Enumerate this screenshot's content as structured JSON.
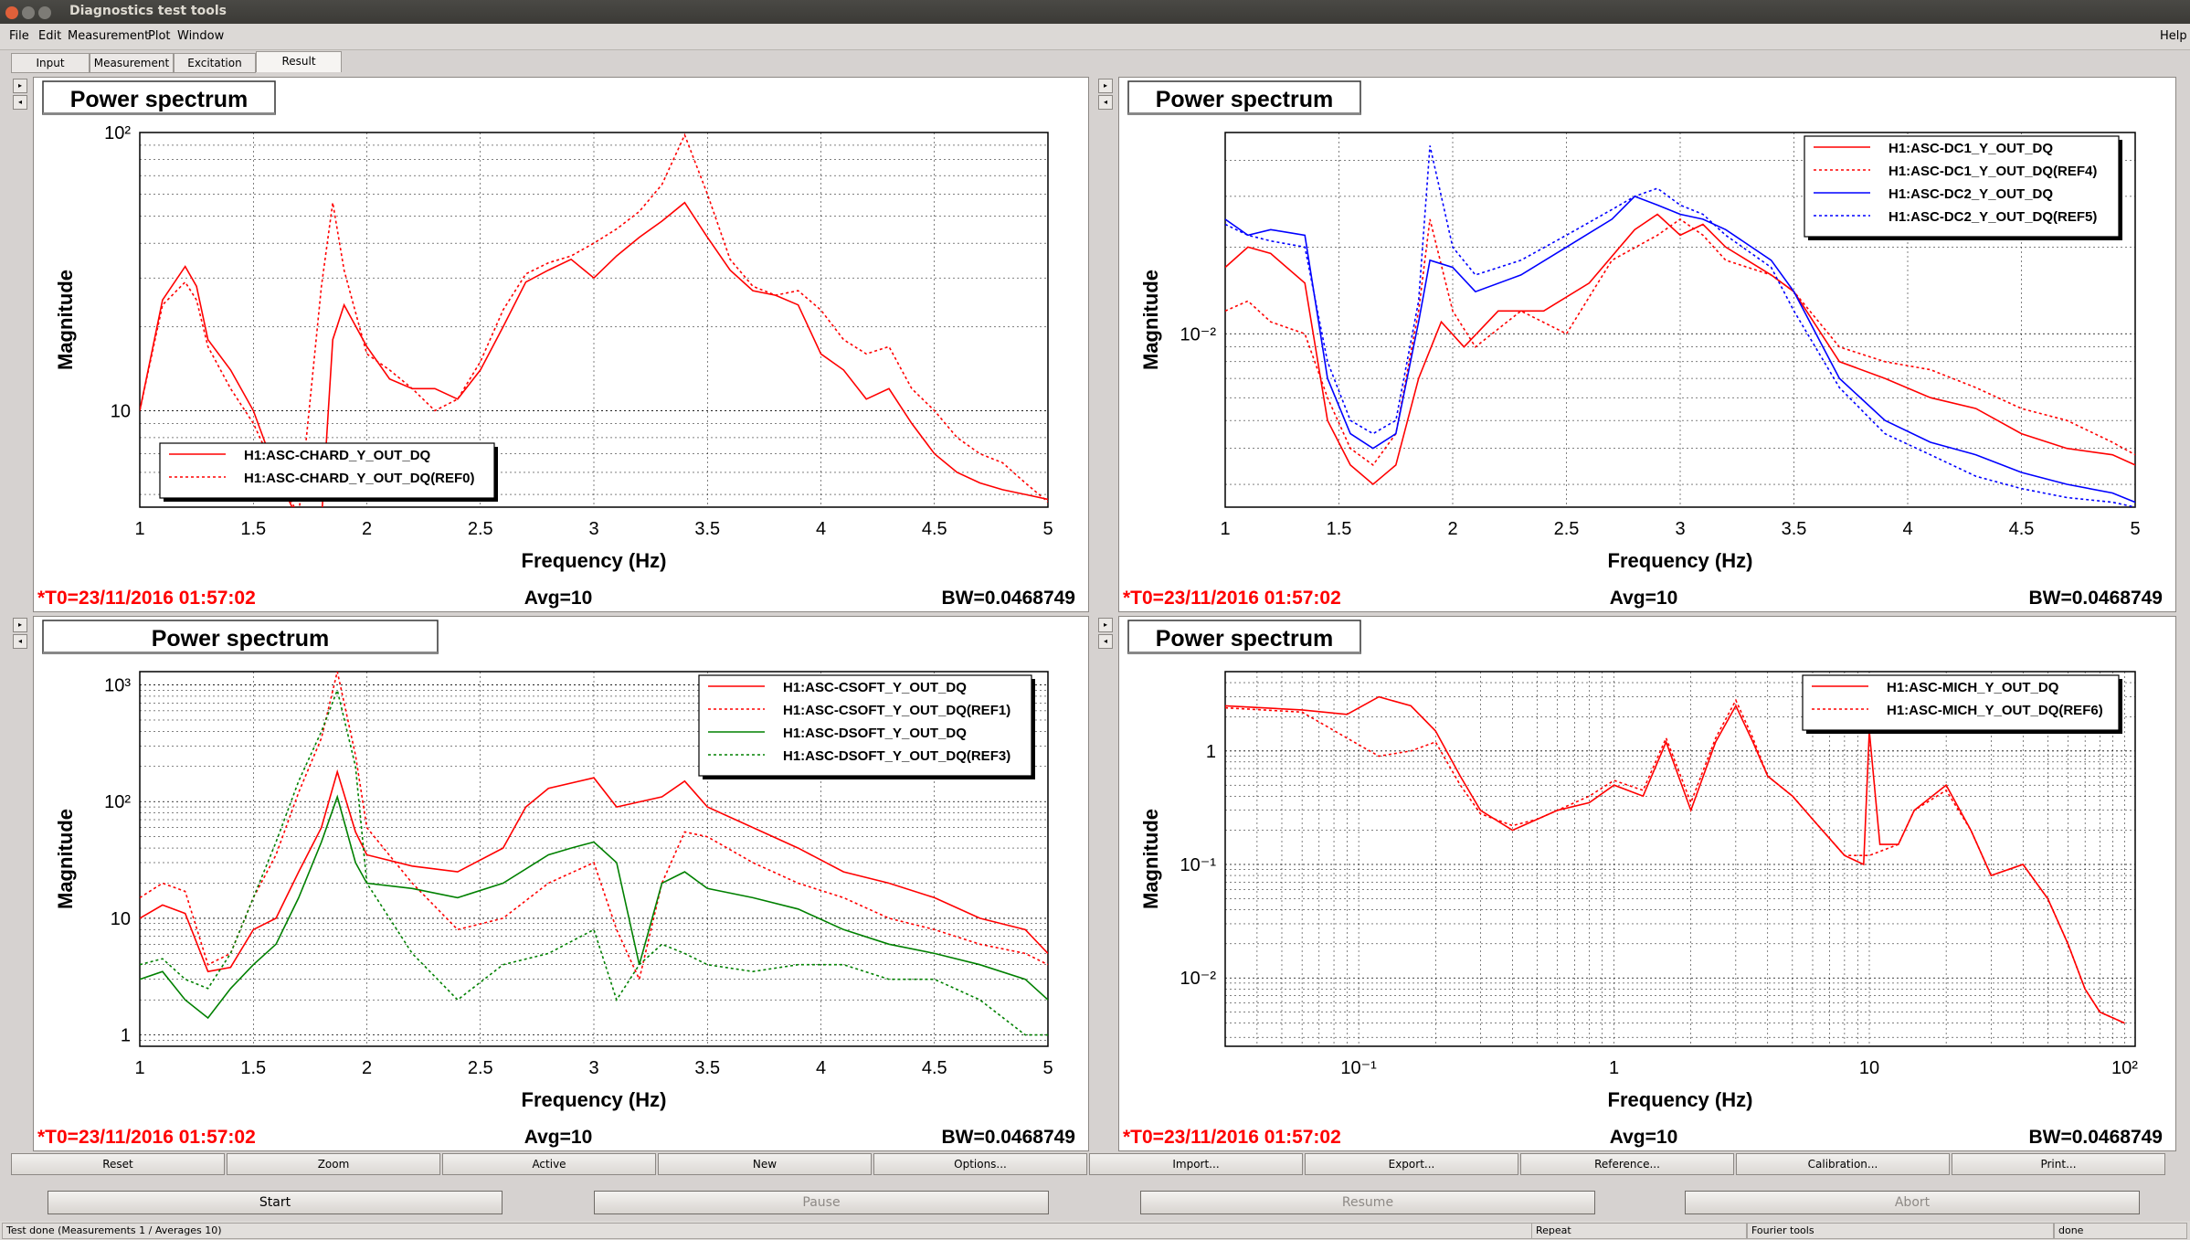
{
  "window": {
    "title": "Diagnostics test tools"
  },
  "menu": {
    "file": "File",
    "edit": "Edit",
    "measurement": "Measurement",
    "plot": "Plot",
    "window": "Window",
    "help": "Help"
  },
  "tabs": [
    "Input",
    "Measurement",
    "Excitation",
    "Result"
  ],
  "active_tab": "Result",
  "plots": [
    {
      "title": "Power spectrum",
      "t0": "*T0=23/11/2016 01:57:02",
      "avg": "Avg=10",
      "bw": "BW=0.0468749",
      "xlabel": "Frequency (Hz)",
      "ylabel": "Magnitude",
      "legend": [
        "H1:ASC-CHARD_Y_OUT_DQ",
        "H1:ASC-CHARD_Y_OUT_DQ(REF0)"
      ]
    },
    {
      "title": "Power spectrum",
      "t0": "*T0=23/11/2016 01:57:02",
      "avg": "Avg=10",
      "bw": "BW=0.0468749",
      "xlabel": "Frequency (Hz)",
      "ylabel": "Magnitude",
      "legend": [
        "H1:ASC-DC1_Y_OUT_DQ",
        "H1:ASC-DC1_Y_OUT_DQ(REF4)",
        "H1:ASC-DC2_Y_OUT_DQ",
        "H1:ASC-DC2_Y_OUT_DQ(REF5)"
      ]
    },
    {
      "title": "Power spectrum",
      "t0": "*T0=23/11/2016 01:57:02",
      "avg": "Avg=10",
      "bw": "BW=0.0468749",
      "xlabel": "Frequency (Hz)",
      "ylabel": "Magnitude",
      "legend": [
        "H1:ASC-CSOFT_Y_OUT_DQ",
        "H1:ASC-CSOFT_Y_OUT_DQ(REF1)",
        "H1:ASC-DSOFT_Y_OUT_DQ",
        "H1:ASC-DSOFT_Y_OUT_DQ(REF3)"
      ]
    },
    {
      "title": "Power spectrum",
      "t0": "*T0=23/11/2016 01:57:02",
      "avg": "Avg=10",
      "bw": "BW=0.0468749",
      "xlabel": "Frequency (Hz)",
      "ylabel": "Magnitude",
      "legend": [
        "H1:ASC-MICH_Y_OUT_DQ",
        "H1:ASC-MICH_Y_OUT_DQ(REF6)"
      ]
    }
  ],
  "chart_data": [
    {
      "type": "line",
      "x_axis": {
        "min": 1,
        "max": 5,
        "ticks": [
          "1",
          "1.5",
          "2",
          "2.5",
          "3",
          "3.5",
          "4",
          "4.5",
          "5"
        ]
      },
      "y_axis": {
        "scale": "log",
        "min": 4.5,
        "max": 100,
        "ticks": [
          "10",
          "10²"
        ]
      },
      "series": [
        {
          "name": "H1:ASC-CHARD_Y_OUT_DQ",
          "color": "#ff0000",
          "dash": "solid",
          "x": [
            1.0,
            1.1,
            1.2,
            1.25,
            1.3,
            1.4,
            1.5,
            1.6,
            1.7,
            1.8,
            1.85,
            1.9,
            2.0,
            2.1,
            2.2,
            2.3,
            2.4,
            2.5,
            2.6,
            2.7,
            2.8,
            2.9,
            3.0,
            3.1,
            3.2,
            3.3,
            3.4,
            3.5,
            3.6,
            3.7,
            3.8,
            3.9,
            4.0,
            4.1,
            4.2,
            4.3,
            4.4,
            4.5,
            4.6,
            4.7,
            4.8,
            4.9,
            5.0
          ],
          "y": [
            10,
            25,
            33,
            28,
            18,
            14,
            10,
            6,
            4,
            4,
            18,
            24,
            17,
            13,
            12,
            12,
            11,
            14,
            20,
            29,
            32,
            35,
            30,
            36,
            42,
            48,
            56,
            42,
            32,
            27,
            26,
            24,
            16,
            14,
            11,
            12,
            9,
            7,
            6,
            5.5,
            5.2,
            5,
            4.8
          ]
        },
        {
          "name": "H1:ASC-CHARD_Y_OUT_DQ(REF0)",
          "color": "#ff0000",
          "dash": "dotted",
          "x": [
            1.0,
            1.1,
            1.2,
            1.25,
            1.3,
            1.4,
            1.5,
            1.6,
            1.7,
            1.8,
            1.85,
            1.9,
            2.0,
            2.1,
            2.2,
            2.3,
            2.4,
            2.5,
            2.6,
            2.7,
            2.8,
            2.9,
            3.0,
            3.1,
            3.2,
            3.3,
            3.4,
            3.5,
            3.6,
            3.7,
            3.8,
            3.9,
            4.0,
            4.1,
            4.2,
            4.3,
            4.4,
            4.5,
            4.6,
            4.7,
            4.8,
            4.9,
            5.0
          ],
          "y": [
            10,
            24,
            29,
            25,
            17,
            12,
            9,
            6,
            4.2,
            28,
            56,
            32,
            16,
            14,
            12,
            10,
            11,
            15,
            23,
            31,
            34,
            36,
            40,
            45,
            52,
            65,
            98,
            60,
            35,
            28,
            26,
            27,
            23,
            18,
            16,
            17,
            12,
            10,
            8,
            7,
            6.5,
            5.5,
            4.7
          ]
        }
      ]
    },
    {
      "type": "line",
      "x_axis": {
        "min": 1,
        "max": 5,
        "ticks": [
          "1",
          "1.5",
          "2",
          "2.5",
          "3",
          "3.5",
          "4",
          "4.5",
          "5"
        ]
      },
      "y_axis": {
        "scale": "log",
        "min": 0.0025,
        "max": 0.05,
        "ticks": [
          "10⁻²"
        ]
      },
      "series": [
        {
          "name": "H1:ASC-DC1_Y_OUT_DQ",
          "color": "#ff0000",
          "dash": "solid",
          "x": [
            1.0,
            1.1,
            1.2,
            1.35,
            1.45,
            1.55,
            1.65,
            1.75,
            1.85,
            1.95,
            2.05,
            2.2,
            2.4,
            2.6,
            2.8,
            2.9,
            3.0,
            3.1,
            3.2,
            3.4,
            3.5,
            3.7,
            3.9,
            4.1,
            4.3,
            4.5,
            4.7,
            4.9,
            5.0
          ],
          "y": [
            0.017,
            0.02,
            0.019,
            0.015,
            0.005,
            0.0035,
            0.003,
            0.0035,
            0.007,
            0.011,
            0.009,
            0.012,
            0.012,
            0.015,
            0.023,
            0.026,
            0.022,
            0.024,
            0.02,
            0.016,
            0.014,
            0.008,
            0.007,
            0.006,
            0.0055,
            0.0045,
            0.004,
            0.0038,
            0.0035
          ]
        },
        {
          "name": "H1:ASC-DC1_Y_OUT_DQ(REF4)",
          "color": "#ff0000",
          "dash": "dotted",
          "x": [
            1.0,
            1.1,
            1.2,
            1.35,
            1.45,
            1.55,
            1.65,
            1.75,
            1.85,
            1.9,
            2.0,
            2.1,
            2.3,
            2.5,
            2.7,
            2.9,
            3.0,
            3.1,
            3.2,
            3.4,
            3.5,
            3.7,
            3.9,
            4.1,
            4.3,
            4.5,
            4.7,
            4.9,
            5.0
          ],
          "y": [
            0.012,
            0.013,
            0.011,
            0.01,
            0.006,
            0.004,
            0.0035,
            0.0045,
            0.012,
            0.025,
            0.012,
            0.009,
            0.012,
            0.01,
            0.018,
            0.022,
            0.025,
            0.022,
            0.018,
            0.016,
            0.014,
            0.009,
            0.008,
            0.0075,
            0.0065,
            0.0055,
            0.005,
            0.0042,
            0.0038
          ]
        },
        {
          "name": "H1:ASC-DC2_Y_OUT_DQ",
          "color": "#0000ff",
          "dash": "solid",
          "x": [
            1.0,
            1.1,
            1.2,
            1.35,
            1.45,
            1.55,
            1.65,
            1.75,
            1.85,
            1.9,
            2.0,
            2.1,
            2.3,
            2.5,
            2.7,
            2.8,
            2.9,
            3.0,
            3.1,
            3.2,
            3.4,
            3.5,
            3.7,
            3.9,
            4.1,
            4.3,
            4.5,
            4.7,
            4.9,
            5.0
          ],
          "y": [
            0.025,
            0.022,
            0.023,
            0.022,
            0.007,
            0.0045,
            0.004,
            0.0045,
            0.011,
            0.018,
            0.017,
            0.014,
            0.016,
            0.02,
            0.025,
            0.03,
            0.028,
            0.026,
            0.025,
            0.023,
            0.018,
            0.014,
            0.007,
            0.005,
            0.0042,
            0.0038,
            0.0033,
            0.003,
            0.0028,
            0.0026
          ]
        },
        {
          "name": "H1:ASC-DC2_Y_OUT_DQ(REF5)",
          "color": "#0000ff",
          "dash": "dotted",
          "x": [
            1.0,
            1.1,
            1.2,
            1.35,
            1.45,
            1.55,
            1.65,
            1.75,
            1.85,
            1.9,
            2.0,
            2.1,
            2.3,
            2.5,
            2.7,
            2.8,
            2.9,
            3.0,
            3.1,
            3.2,
            3.4,
            3.5,
            3.7,
            3.9,
            4.1,
            4.3,
            4.5,
            4.7,
            4.9,
            5.0
          ],
          "y": [
            0.024,
            0.022,
            0.021,
            0.02,
            0.008,
            0.005,
            0.0045,
            0.005,
            0.013,
            0.045,
            0.02,
            0.016,
            0.018,
            0.022,
            0.027,
            0.03,
            0.032,
            0.028,
            0.026,
            0.022,
            0.017,
            0.012,
            0.0065,
            0.0045,
            0.0038,
            0.0032,
            0.0029,
            0.0027,
            0.0026,
            0.0025
          ]
        }
      ]
    },
    {
      "type": "line",
      "x_axis": {
        "min": 1,
        "max": 5,
        "ticks": [
          "1",
          "1.5",
          "2",
          "2.5",
          "3",
          "3.5",
          "4",
          "4.5",
          "5"
        ]
      },
      "y_axis": {
        "scale": "log",
        "min": 0.8,
        "max": 1300,
        "ticks": [
          "1",
          "10",
          "10²",
          "10³"
        ]
      },
      "series": [
        {
          "name": "H1:ASC-CSOFT_Y_OUT_DQ",
          "color": "#ff0000",
          "dash": "solid",
          "x": [
            1.0,
            1.1,
            1.2,
            1.3,
            1.4,
            1.5,
            1.6,
            1.7,
            1.8,
            1.87,
            1.95,
            2.0,
            2.2,
            2.4,
            2.6,
            2.7,
            2.8,
            3.0,
            3.1,
            3.3,
            3.4,
            3.5,
            3.7,
            3.9,
            4.1,
            4.3,
            4.5,
            4.7,
            4.9,
            5.0
          ],
          "y": [
            10,
            13,
            11,
            3.5,
            3.8,
            8,
            10,
            25,
            60,
            180,
            55,
            35,
            28,
            25,
            40,
            90,
            130,
            160,
            90,
            110,
            150,
            90,
            60,
            40,
            25,
            20,
            15,
            10,
            8,
            5
          ]
        },
        {
          "name": "H1:ASC-CSOFT_Y_OUT_DQ(REF1)",
          "color": "#ff0000",
          "dash": "dotted",
          "x": [
            1.0,
            1.1,
            1.2,
            1.3,
            1.4,
            1.5,
            1.6,
            1.7,
            1.8,
            1.87,
            1.95,
            2.0,
            2.2,
            2.4,
            2.6,
            2.8,
            3.0,
            3.1,
            3.2,
            3.3,
            3.4,
            3.5,
            3.7,
            3.9,
            4.1,
            4.3,
            4.5,
            4.7,
            4.9,
            5.0
          ],
          "y": [
            15,
            20,
            17,
            4,
            5,
            15,
            35,
            120,
            350,
            1300,
            250,
            60,
            20,
            8,
            10,
            20,
            30,
            8,
            3,
            20,
            55,
            50,
            30,
            20,
            15,
            10,
            8,
            6,
            5,
            4
          ]
        },
        {
          "name": "H1:ASC-DSOFT_Y_OUT_DQ",
          "color": "#008000",
          "dash": "solid",
          "x": [
            1.0,
            1.1,
            1.2,
            1.3,
            1.4,
            1.5,
            1.6,
            1.7,
            1.8,
            1.87,
            1.95,
            2.0,
            2.2,
            2.4,
            2.6,
            2.8,
            2.9,
            3.0,
            3.1,
            3.2,
            3.3,
            3.4,
            3.5,
            3.7,
            3.9,
            4.1,
            4.3,
            4.5,
            4.7,
            4.9,
            5.0
          ],
          "y": [
            3,
            3.5,
            2,
            1.4,
            2.5,
            4,
            6,
            15,
            45,
            110,
            30,
            20,
            18,
            15,
            20,
            35,
            40,
            45,
            30,
            4,
            20,
            25,
            18,
            15,
            12,
            8,
            6,
            5,
            4,
            3,
            2
          ]
        },
        {
          "name": "H1:ASC-DSOFT_Y_OUT_DQ(REF3)",
          "color": "#008000",
          "dash": "dotted",
          "x": [
            1.0,
            1.1,
            1.2,
            1.3,
            1.4,
            1.5,
            1.6,
            1.7,
            1.8,
            1.87,
            1.95,
            2.0,
            2.2,
            2.4,
            2.6,
            2.8,
            3.0,
            3.1,
            3.2,
            3.3,
            3.4,
            3.5,
            3.7,
            3.9,
            4.1,
            4.3,
            4.5,
            4.7,
            4.9,
            5.0
          ],
          "y": [
            4,
            4.5,
            3,
            2.5,
            5,
            15,
            45,
            150,
            400,
            900,
            200,
            20,
            5,
            2,
            4,
            5,
            8,
            2,
            4,
            6,
            5,
            4,
            3.5,
            4,
            4,
            3,
            3,
            2,
            1,
            1
          ]
        }
      ]
    },
    {
      "type": "line",
      "x_axis": {
        "scale": "log",
        "min": 0.03,
        "max": 110,
        "ticks": [
          "10⁻¹",
          "1",
          "10",
          "10²"
        ]
      },
      "y_axis": {
        "scale": "log",
        "min": 0.0025,
        "max": 5,
        "ticks": [
          "10⁻²",
          "10⁻¹",
          "1"
        ]
      },
      "series": [
        {
          "name": "H1:ASC-MICH_Y_OUT_DQ",
          "color": "#ff0000",
          "dash": "solid",
          "x": [
            0.03,
            0.06,
            0.09,
            0.12,
            0.16,
            0.2,
            0.25,
            0.3,
            0.4,
            0.5,
            0.6,
            0.8,
            1.0,
            1.3,
            1.6,
            2.0,
            2.5,
            3.0,
            3.5,
            4.0,
            5.0,
            6.0,
            8.0,
            9.5,
            10,
            11,
            13,
            15,
            20,
            25,
            30,
            40,
            50,
            60,
            70,
            80,
            100
          ],
          "y": [
            2.5,
            2.3,
            2.1,
            3.0,
            2.5,
            1.5,
            0.6,
            0.3,
            0.2,
            0.25,
            0.3,
            0.35,
            0.5,
            0.4,
            1.2,
            0.3,
            1.2,
            2.5,
            1.2,
            0.6,
            0.4,
            0.25,
            0.12,
            0.1,
            1.5,
            0.15,
            0.15,
            0.3,
            0.5,
            0.2,
            0.08,
            0.1,
            0.05,
            0.02,
            0.008,
            0.005,
            0.004
          ]
        },
        {
          "name": "H1:ASC-MICH_Y_OUT_DQ(REF6)",
          "color": "#ff0000",
          "dash": "dotted",
          "x": [
            0.03,
            0.06,
            0.09,
            0.12,
            0.16,
            0.2,
            0.25,
            0.3,
            0.4,
            0.5,
            0.6,
            0.8,
            1.0,
            1.3,
            1.6,
            2.0,
            2.5,
            3.0,
            3.5,
            4.0,
            5.0,
            6.0,
            8.0,
            10,
            13,
            15,
            20,
            25,
            30,
            40,
            50,
            60,
            70,
            80,
            100
          ],
          "y": [
            2.4,
            2.2,
            1.3,
            0.9,
            1.0,
            1.2,
            0.5,
            0.28,
            0.22,
            0.25,
            0.3,
            0.4,
            0.55,
            0.45,
            1.3,
            0.35,
            1.3,
            2.8,
            1.3,
            0.6,
            0.4,
            0.25,
            0.12,
            0.12,
            0.15,
            0.3,
            0.45,
            0.2,
            0.08,
            0.1,
            0.05,
            0.02,
            0.008,
            0.005,
            0.004
          ]
        }
      ]
    }
  ],
  "buttons": [
    "Reset",
    "Zoom",
    "Active",
    "New",
    "Options...",
    "Import...",
    "Export...",
    "Reference...",
    "Calibration...",
    "Print..."
  ],
  "controls": [
    "Start",
    "Pause",
    "Resume",
    "Abort"
  ],
  "status": [
    "Test done (Measurements 1 / Averages 10)",
    "Repeat",
    "Fourier tools",
    "done"
  ]
}
